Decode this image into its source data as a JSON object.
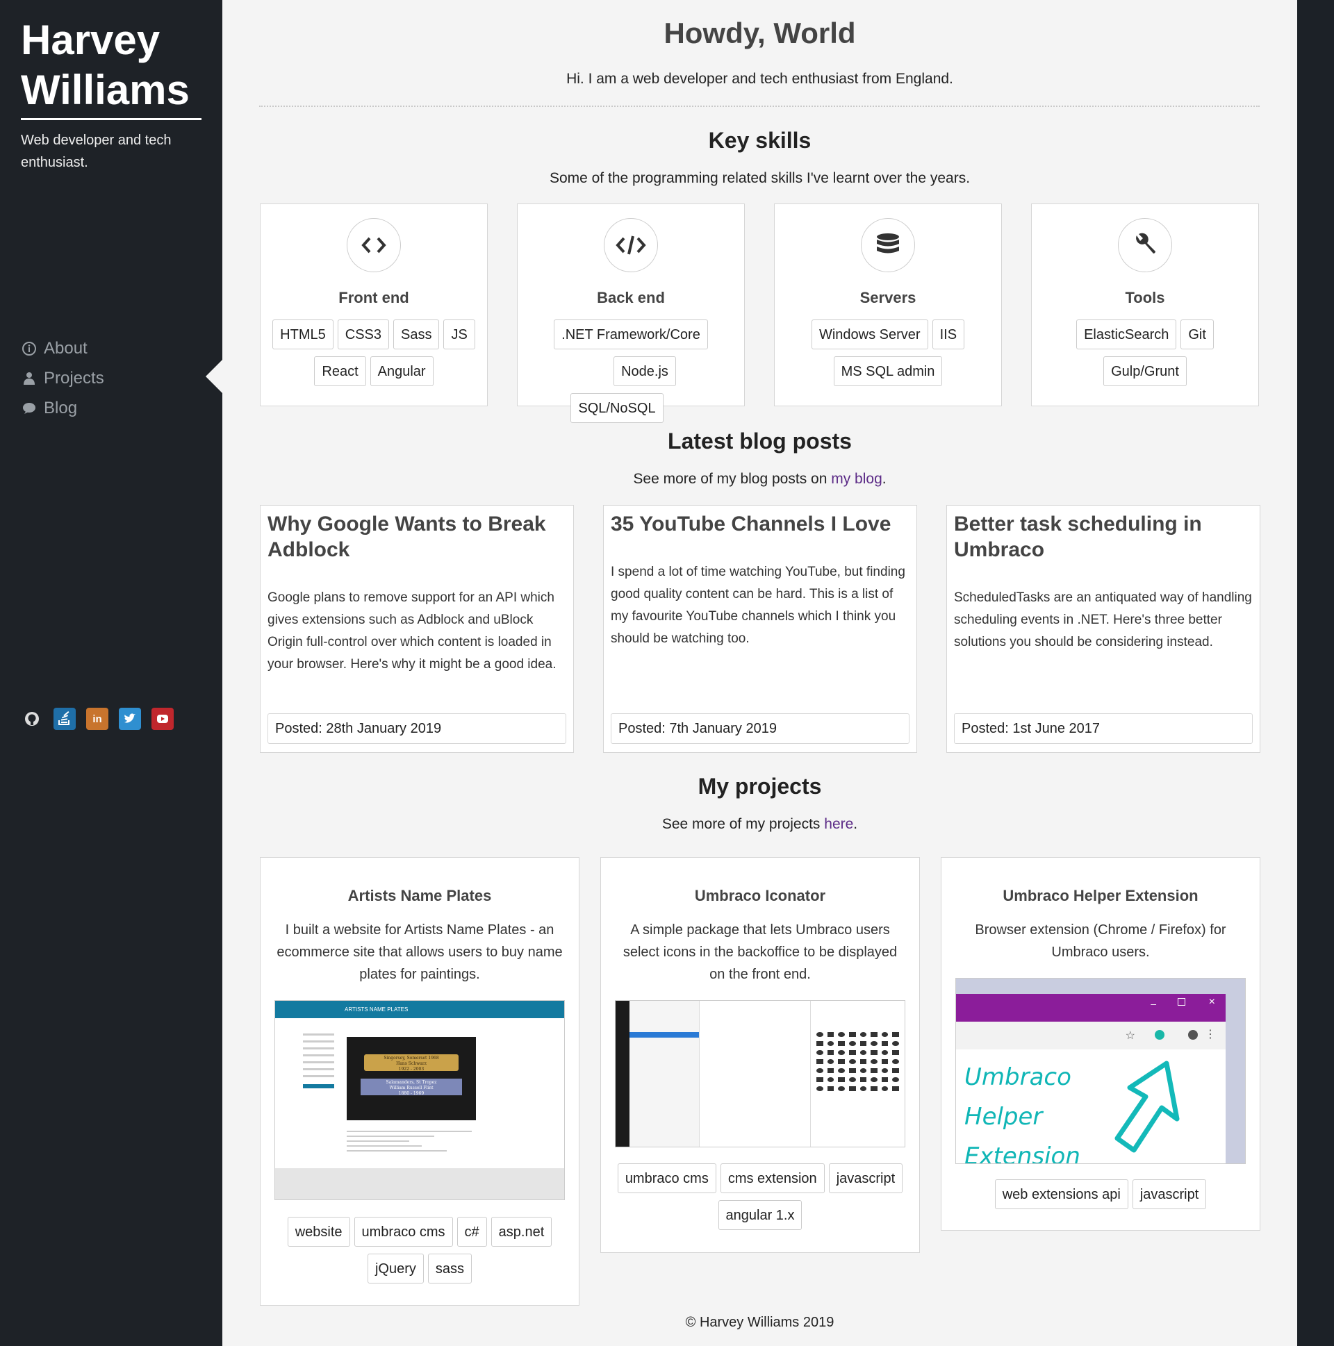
{
  "sidebar": {
    "name": "Harvey Williams",
    "tagline": "Web developer and tech enthusiast.",
    "nav": [
      {
        "label": "About",
        "icon": "info-icon"
      },
      {
        "label": "Projects",
        "icon": "user-icon"
      },
      {
        "label": "Blog",
        "icon": "speech-bubble-icon"
      }
    ],
    "active_item": "Projects",
    "social": [
      {
        "icon": "github-icon",
        "color": "#1e2227"
      },
      {
        "icon": "stackoverflow-icon",
        "color": "#1f6fa8"
      },
      {
        "icon": "linkedin-icon",
        "color": "#c8742d"
      },
      {
        "icon": "twitter-icon",
        "color": "#2f8fd0"
      },
      {
        "icon": "youtube-icon",
        "color": "#c0272d"
      }
    ]
  },
  "main": {
    "heading": "Howdy, World",
    "intro": "Hi. I am a web developer and tech enthusiast from England.",
    "skills": {
      "title": "Key skills",
      "subtitle": "Some of the programming related skills I've learnt over the years.",
      "cards": [
        {
          "name": "Front end",
          "icon": "code-brackets-icon",
          "tags": [
            "HTML5",
            "CSS3",
            "Sass",
            "JS",
            "React",
            "Angular"
          ]
        },
        {
          "name": "Back end",
          "icon": "code-slash-icon",
          "tags": [
            ".NET Framework/Core",
            "Node.js",
            "SQL/NoSQL"
          ]
        },
        {
          "name": "Servers",
          "icon": "database-icon",
          "tags": [
            "Windows Server",
            "IIS",
            "MS SQL admin"
          ]
        },
        {
          "name": "Tools",
          "icon": "wrench-icon",
          "tags": [
            "ElasticSearch",
            "Git",
            "Gulp/Grunt"
          ]
        }
      ]
    },
    "blog": {
      "title": "Latest blog posts",
      "subtitle_before": "See more of my blog posts on ",
      "subtitle_link": "my blog",
      "subtitle_after": ".",
      "posts": [
        {
          "title": "Why Google Wants to Break Adblock",
          "description": "Google plans to remove support for an API which gives extensions such as Adblock and uBlock Origin full-control over which content is loaded in your browser. Here's why it might be a good idea.",
          "date": "Posted: 28th January 2019"
        },
        {
          "title": "35 YouTube Channels I Love",
          "description": "I spend a lot of time watching YouTube, but finding good quality content can be hard. This is a list of my favourite YouTube channels which I think you should be watching too.",
          "date": "Posted: 7th January 2019"
        },
        {
          "title": "Better task scheduling in Umbraco",
          "description": "ScheduledTasks are an antiquated way of handling scheduling events in .NET. Here's three better solutions you should be considering instead.",
          "date": "Posted: 1st June 2017"
        }
      ]
    },
    "projects": {
      "title": "My projects",
      "subtitle_before": "See more of my projects ",
      "subtitle_link": "here",
      "subtitle_after": ".",
      "items": [
        {
          "title": "Artists Name Plates",
          "description": "I built a website for Artists Name Plates - an ecommerce site that allows users to buy name plates for paintings.",
          "tags": [
            "website",
            "umbraco cms",
            "c#",
            "asp.net",
            "jQuery",
            "sass"
          ],
          "screenshot": {
            "header": "ARTISTS NAME PLATES",
            "plate1_line1": "Singorsey, Somerset 1968",
            "plate1_line2": "Hans Schwarz",
            "plate1_line3": "1922 - 2003",
            "plate2_line1": "Salamanders, St Tropez",
            "plate2_line2": "William Russell Flint",
            "plate2_line3": "1880 - 1969"
          }
        },
        {
          "title": "Umbraco Iconator",
          "description": "A simple package that lets Umbraco users select icons in the backoffice to be displayed on the front end.",
          "tags": [
            "umbraco cms",
            "cms extension",
            "javascript",
            "angular 1.x"
          ]
        },
        {
          "title": "Umbraco Helper Extension",
          "description": "Browser extension (Chrome / Firefox) for Umbraco users.",
          "tags": [
            "web extensions api",
            "javascript"
          ],
          "screenshot": {
            "line1": "Umbraco",
            "line2": "Helper",
            "line3": "Extension"
          }
        }
      ]
    },
    "footer": "© Harvey Williams 2019"
  }
}
